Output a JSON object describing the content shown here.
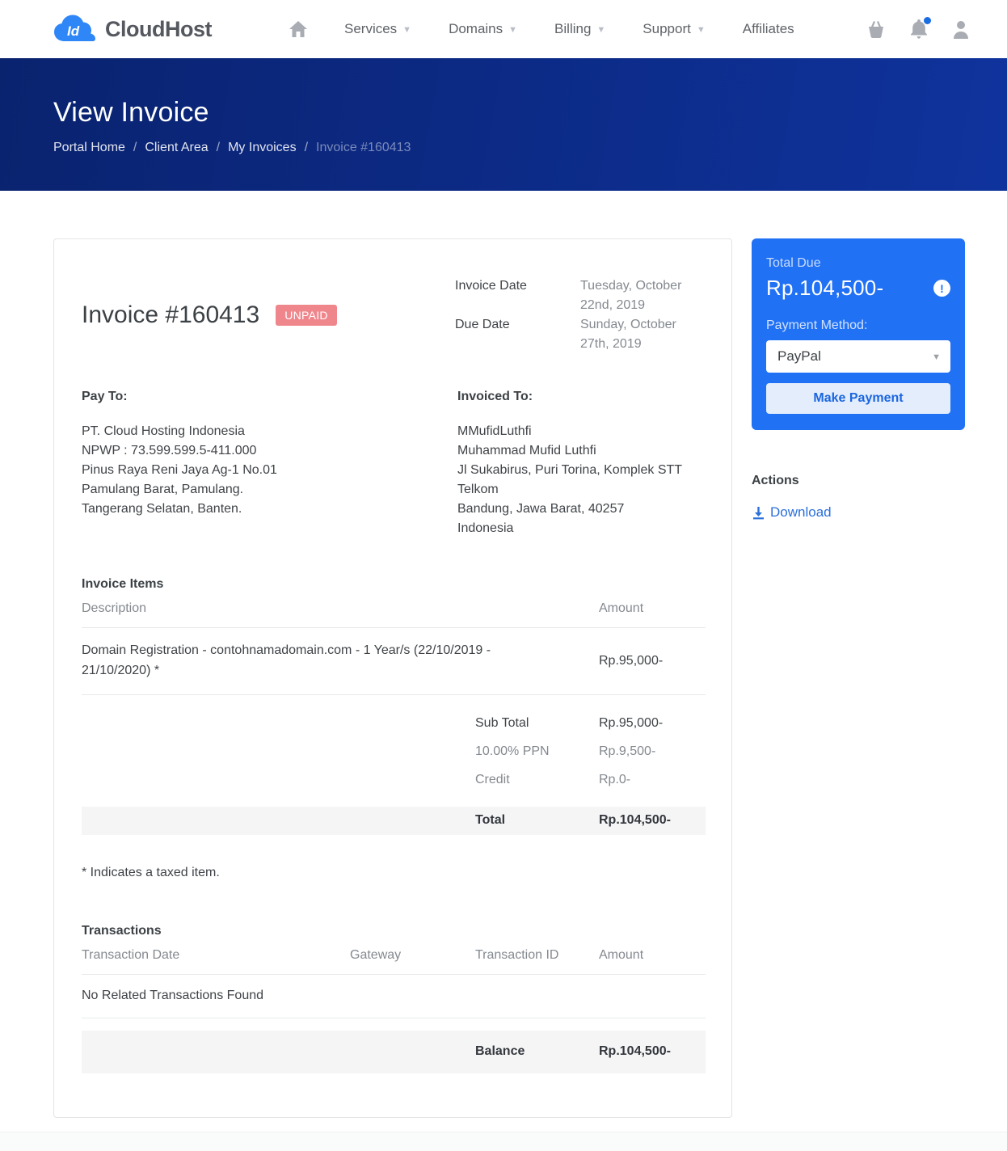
{
  "brand": {
    "logo_badge": "Id",
    "name": "CloudHost"
  },
  "nav": {
    "items": [
      {
        "label": "Services"
      },
      {
        "label": "Domains"
      },
      {
        "label": "Billing"
      },
      {
        "label": "Support"
      },
      {
        "label": "Affiliates"
      }
    ]
  },
  "hero": {
    "title": "View Invoice",
    "separator": "/",
    "breadcrumbs": [
      "Portal Home",
      "Client Area",
      "My Invoices",
      "Invoice #160413"
    ]
  },
  "invoice": {
    "title": "Invoice #160413",
    "status_badge": "UNPAID",
    "invoice_date_label": "Invoice Date",
    "invoice_date": "Tuesday, October 22nd, 2019",
    "due_date_label": "Due Date",
    "due_date": "Sunday, October 27th, 2019",
    "pay_to_label": "Pay To:",
    "pay_to_lines": [
      "PT. Cloud Hosting Indonesia",
      "NPWP : 73.599.599.5-411.000",
      "Pinus Raya Reni Jaya Ag-1 No.01",
      "Pamulang Barat, Pamulang.",
      "Tangerang Selatan, Banten."
    ],
    "invoiced_to_label": "Invoiced To:",
    "invoiced_to_lines": [
      "MMufidLuthfi",
      "Muhammad Mufid Luthfi",
      "Jl Sukabirus, Puri Torina, Komplek STT Telkom",
      "Bandung, Jawa Barat, 40257",
      "Indonesia"
    ],
    "items_heading": "Invoice Items",
    "items_columns": {
      "description": "Description",
      "amount": "Amount"
    },
    "items": [
      {
        "description": "Domain Registration - contohnamadomain.com - 1 Year/s (22/10/2019 - 21/10/2020) *",
        "amount": "Rp.95,000-"
      }
    ],
    "totals": {
      "sub_total_label": "Sub Total",
      "sub_total": "Rp.95,000-",
      "tax_label": "10.00% PPN",
      "tax": "Rp.9,500-",
      "credit_label": "Credit",
      "credit": "Rp.0-",
      "total_label": "Total",
      "total": "Rp.104,500-"
    },
    "taxed_note": "* Indicates a taxed item.",
    "transactions": {
      "heading": "Transactions",
      "columns": [
        "Transaction Date",
        "Gateway",
        "Transaction ID",
        "Amount"
      ],
      "empty_message": "No Related Transactions Found",
      "balance_label": "Balance",
      "balance": "Rp.104,500-"
    }
  },
  "sidebar": {
    "total_due_label": "Total Due",
    "total_due": "Rp.104,500-",
    "info_icon_glyph": "!",
    "payment_method_label": "Payment Method:",
    "payment_method_selected": "PayPal",
    "make_payment_label": "Make Payment",
    "actions_heading": "Actions",
    "download_label": "Download"
  },
  "colors": {
    "accent_blue": "#2171f5",
    "hero_blue_dark": "#0a236f",
    "hero_blue_light": "#0f339d",
    "unpaid_badge": "#ef868c",
    "link_blue": "#2a6fdb",
    "logo_blue": "#2e86f7"
  }
}
